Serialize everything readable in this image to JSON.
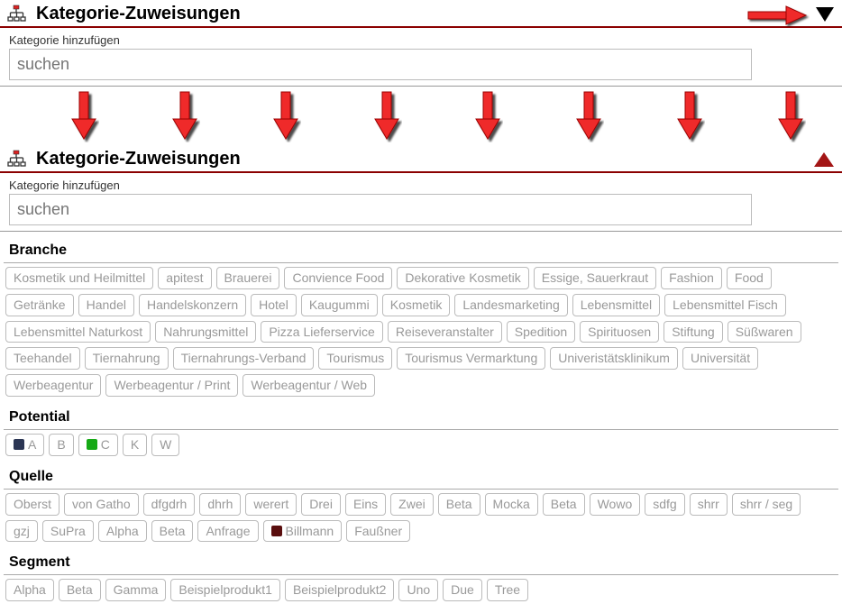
{
  "panel1": {
    "title": "Kategorie-Zuweisungen",
    "field_label": "Kategorie hinzufügen",
    "search_placeholder": "suchen"
  },
  "panel2": {
    "title": "Kategorie-Zuweisungen",
    "field_label": "Kategorie hinzufügen",
    "search_placeholder": "suchen",
    "sections": {
      "branche": {
        "title": "Branche",
        "tags": [
          "Kosmetik und Heilmittel",
          "apitest",
          "Brauerei",
          "Convience Food",
          "Dekorative Kosmetik",
          "Essige, Sauerkraut",
          "Fashion",
          "Food",
          "Getränke",
          "Handel",
          "Handelskonzern",
          "Hotel",
          "Kaugummi",
          "Kosmetik",
          "Landesmarketing",
          "Lebensmittel",
          "Lebensmittel Fisch",
          "Lebensmittel Naturkost",
          "Nahrungsmittel",
          "Pizza Lieferservice",
          "Reiseveranstalter",
          "Spedition",
          "Spirituosen",
          "Stiftung",
          "Süßwaren",
          "Teehandel",
          "Tiernahrung",
          "Tiernahrungs-Verband",
          "Tourismus",
          "Tourismus Vermarktung",
          "Univeristätsklinikum",
          "Universität",
          "Werbeagentur",
          "Werbeagentur / Print",
          "Werbeagentur / Web"
        ]
      },
      "potential": {
        "title": "Potential",
        "tags": [
          "A",
          "B",
          "C",
          "K",
          "W"
        ]
      },
      "quelle": {
        "title": "Quelle",
        "tags": [
          "Oberst",
          "von Gatho",
          "dfgdrh",
          "dhrh",
          "werert",
          "Drei",
          "Eins",
          "Zwei",
          "Beta",
          "Mocka",
          "Beta",
          "Wowo",
          "sdfg",
          "shrr",
          "shrr / seg",
          "gzj",
          "SuPra",
          "Alpha",
          "Beta",
          "Anfrage",
          "Billmann",
          "Faußner"
        ]
      },
      "segment": {
        "title": "Segment",
        "tags": [
          "Alpha",
          "Beta",
          "Gamma",
          "Beispielprodukt1",
          "Beispielprodukt2",
          "Uno",
          "Due",
          "Tree"
        ]
      }
    }
  }
}
